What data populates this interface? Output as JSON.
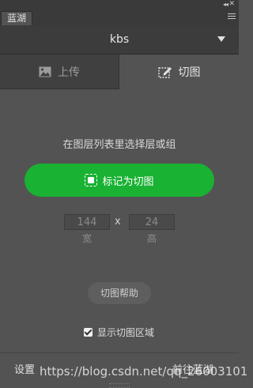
{
  "panel": {
    "tab_label": "蓝湖",
    "collapse_glyph": "◂◂",
    "close_glyph": "✕"
  },
  "account": {
    "name": "kbs"
  },
  "tabs": [
    {
      "label": "上传",
      "icon": "image-icon",
      "active": false
    },
    {
      "label": "切图",
      "icon": "slice-icon",
      "active": true
    }
  ],
  "main": {
    "hint": "在图层列表里选择层或组",
    "mark_button_label": "标记为切图",
    "width_value": "144",
    "height_value": "24",
    "separator": "x",
    "width_label": "宽",
    "height_label": "高",
    "help_button_label": "切图帮助",
    "show_area_label": "显示切图区域",
    "show_area_checked": true
  },
  "footer": {
    "settings_label": "设置",
    "goto_label": "前往蓝湖"
  },
  "watermark": "https://blog.csdn.net/qq_26003101",
  "colors": {
    "accent_green": "#19b233",
    "panel_bg": "#535353"
  }
}
